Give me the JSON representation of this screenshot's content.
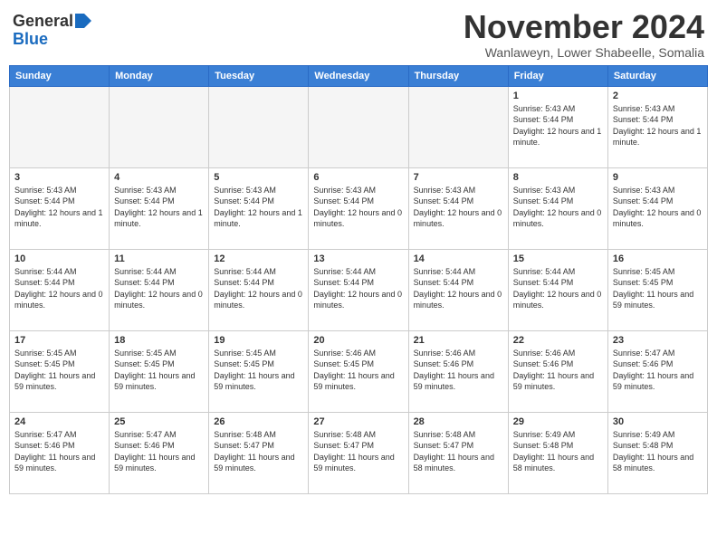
{
  "logo": {
    "general": "General",
    "blue": "Blue"
  },
  "title": "November 2024",
  "location": "Wanlaweyn, Lower Shabeelle, Somalia",
  "days_of_week": [
    "Sunday",
    "Monday",
    "Tuesday",
    "Wednesday",
    "Thursday",
    "Friday",
    "Saturday"
  ],
  "weeks": [
    [
      {
        "day": "",
        "info": ""
      },
      {
        "day": "",
        "info": ""
      },
      {
        "day": "",
        "info": ""
      },
      {
        "day": "",
        "info": ""
      },
      {
        "day": "",
        "info": ""
      },
      {
        "day": "1",
        "info": "Sunrise: 5:43 AM\nSunset: 5:44 PM\nDaylight: 12 hours and 1 minute."
      },
      {
        "day": "2",
        "info": "Sunrise: 5:43 AM\nSunset: 5:44 PM\nDaylight: 12 hours and 1 minute."
      }
    ],
    [
      {
        "day": "3",
        "info": "Sunrise: 5:43 AM\nSunset: 5:44 PM\nDaylight: 12 hours and 1 minute."
      },
      {
        "day": "4",
        "info": "Sunrise: 5:43 AM\nSunset: 5:44 PM\nDaylight: 12 hours and 1 minute."
      },
      {
        "day": "5",
        "info": "Sunrise: 5:43 AM\nSunset: 5:44 PM\nDaylight: 12 hours and 1 minute."
      },
      {
        "day": "6",
        "info": "Sunrise: 5:43 AM\nSunset: 5:44 PM\nDaylight: 12 hours and 0 minutes."
      },
      {
        "day": "7",
        "info": "Sunrise: 5:43 AM\nSunset: 5:44 PM\nDaylight: 12 hours and 0 minutes."
      },
      {
        "day": "8",
        "info": "Sunrise: 5:43 AM\nSunset: 5:44 PM\nDaylight: 12 hours and 0 minutes."
      },
      {
        "day": "9",
        "info": "Sunrise: 5:43 AM\nSunset: 5:44 PM\nDaylight: 12 hours and 0 minutes."
      }
    ],
    [
      {
        "day": "10",
        "info": "Sunrise: 5:44 AM\nSunset: 5:44 PM\nDaylight: 12 hours and 0 minutes."
      },
      {
        "day": "11",
        "info": "Sunrise: 5:44 AM\nSunset: 5:44 PM\nDaylight: 12 hours and 0 minutes."
      },
      {
        "day": "12",
        "info": "Sunrise: 5:44 AM\nSunset: 5:44 PM\nDaylight: 12 hours and 0 minutes."
      },
      {
        "day": "13",
        "info": "Sunrise: 5:44 AM\nSunset: 5:44 PM\nDaylight: 12 hours and 0 minutes."
      },
      {
        "day": "14",
        "info": "Sunrise: 5:44 AM\nSunset: 5:44 PM\nDaylight: 12 hours and 0 minutes."
      },
      {
        "day": "15",
        "info": "Sunrise: 5:44 AM\nSunset: 5:44 PM\nDaylight: 12 hours and 0 minutes."
      },
      {
        "day": "16",
        "info": "Sunrise: 5:45 AM\nSunset: 5:45 PM\nDaylight: 11 hours and 59 minutes."
      }
    ],
    [
      {
        "day": "17",
        "info": "Sunrise: 5:45 AM\nSunset: 5:45 PM\nDaylight: 11 hours and 59 minutes."
      },
      {
        "day": "18",
        "info": "Sunrise: 5:45 AM\nSunset: 5:45 PM\nDaylight: 11 hours and 59 minutes."
      },
      {
        "day": "19",
        "info": "Sunrise: 5:45 AM\nSunset: 5:45 PM\nDaylight: 11 hours and 59 minutes."
      },
      {
        "day": "20",
        "info": "Sunrise: 5:46 AM\nSunset: 5:45 PM\nDaylight: 11 hours and 59 minutes."
      },
      {
        "day": "21",
        "info": "Sunrise: 5:46 AM\nSunset: 5:46 PM\nDaylight: 11 hours and 59 minutes."
      },
      {
        "day": "22",
        "info": "Sunrise: 5:46 AM\nSunset: 5:46 PM\nDaylight: 11 hours and 59 minutes."
      },
      {
        "day": "23",
        "info": "Sunrise: 5:47 AM\nSunset: 5:46 PM\nDaylight: 11 hours and 59 minutes."
      }
    ],
    [
      {
        "day": "24",
        "info": "Sunrise: 5:47 AM\nSunset: 5:46 PM\nDaylight: 11 hours and 59 minutes."
      },
      {
        "day": "25",
        "info": "Sunrise: 5:47 AM\nSunset: 5:46 PM\nDaylight: 11 hours and 59 minutes."
      },
      {
        "day": "26",
        "info": "Sunrise: 5:48 AM\nSunset: 5:47 PM\nDaylight: 11 hours and 59 minutes."
      },
      {
        "day": "27",
        "info": "Sunrise: 5:48 AM\nSunset: 5:47 PM\nDaylight: 11 hours and 59 minutes."
      },
      {
        "day": "28",
        "info": "Sunrise: 5:48 AM\nSunset: 5:47 PM\nDaylight: 11 hours and 58 minutes."
      },
      {
        "day": "29",
        "info": "Sunrise: 5:49 AM\nSunset: 5:48 PM\nDaylight: 11 hours and 58 minutes."
      },
      {
        "day": "30",
        "info": "Sunrise: 5:49 AM\nSunset: 5:48 PM\nDaylight: 11 hours and 58 minutes."
      }
    ]
  ]
}
